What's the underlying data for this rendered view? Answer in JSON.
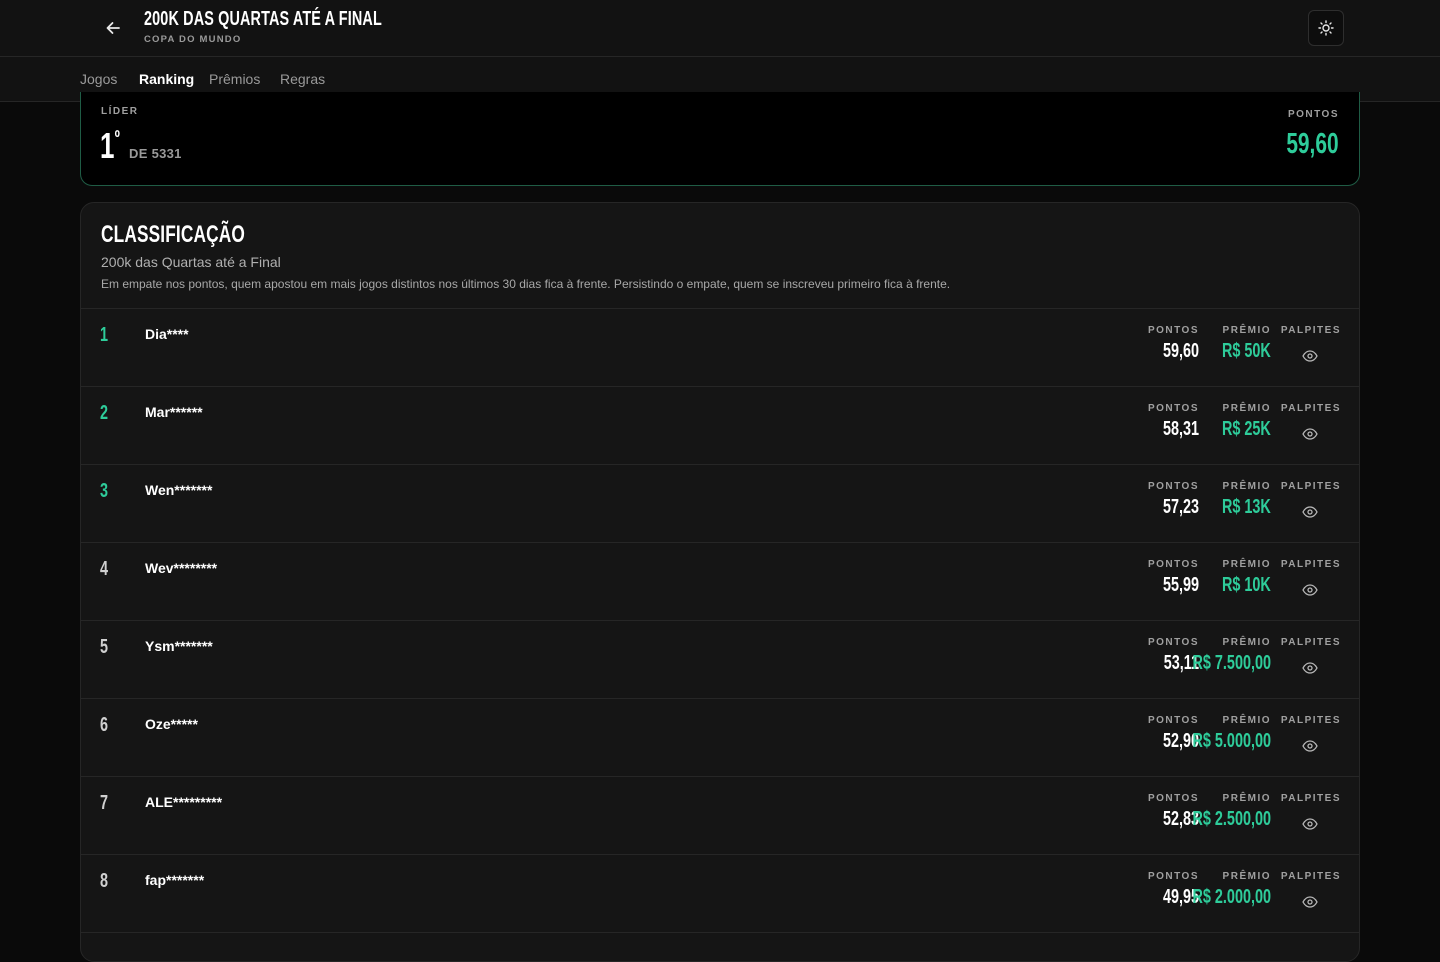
{
  "header": {
    "title": "200K DAS QUARTAS ATÉ A FINAL",
    "subtitle": "COPA DO MUNDO",
    "back_icon": "arrow-left-icon",
    "theme_icon": "sun-icon"
  },
  "tabs": [
    {
      "label": "Jogos",
      "active": false
    },
    {
      "label": "Ranking",
      "active": true
    },
    {
      "label": "Prêmios",
      "active": false
    },
    {
      "label": "Regras",
      "active": false
    }
  ],
  "leader": {
    "label": "LÍDER",
    "rank": "1",
    "rank_suffix": "º",
    "of_total": "DE 5331",
    "points_label": "PONTOS",
    "points": "59,60"
  },
  "classification": {
    "title": "CLASSIFICAÇÃO",
    "subtitle": "200k das Quartas até a Final",
    "note": "Em empate nos pontos, quem apostou em mais jogos distintos nos últimos 30 dias fica à frente. Persistindo o empate, quem se inscreveu primeiro fica à frente.",
    "col_points": "PONTOS",
    "col_prize": "PRÊMIO",
    "col_guesses": "PALPITES",
    "rows": [
      {
        "pos": "1",
        "name": "Dia****",
        "points": "59,60",
        "prize": "R$ 50K"
      },
      {
        "pos": "2",
        "name": "Mar******",
        "points": "58,31",
        "prize": "R$ 25K"
      },
      {
        "pos": "3",
        "name": "Wen*******",
        "points": "57,23",
        "prize": "R$ 13K"
      },
      {
        "pos": "4",
        "name": "Wev********",
        "points": "55,99",
        "prize": "R$ 10K"
      },
      {
        "pos": "5",
        "name": "Ysm*******",
        "points": "53,11",
        "prize": "R$ 7.500,00"
      },
      {
        "pos": "6",
        "name": "Oze*****",
        "points": "52,90",
        "prize": "R$ 5.000,00"
      },
      {
        "pos": "7",
        "name": "ALE*********",
        "points": "52,83",
        "prize": "R$ 2.500,00"
      },
      {
        "pos": "8",
        "name": "fap*******",
        "points": "49,95",
        "prize": "R$ 2.000,00"
      }
    ]
  },
  "colors": {
    "accent": "#2ecc9a",
    "background": "#0a0a0a",
    "card": "#151515"
  }
}
